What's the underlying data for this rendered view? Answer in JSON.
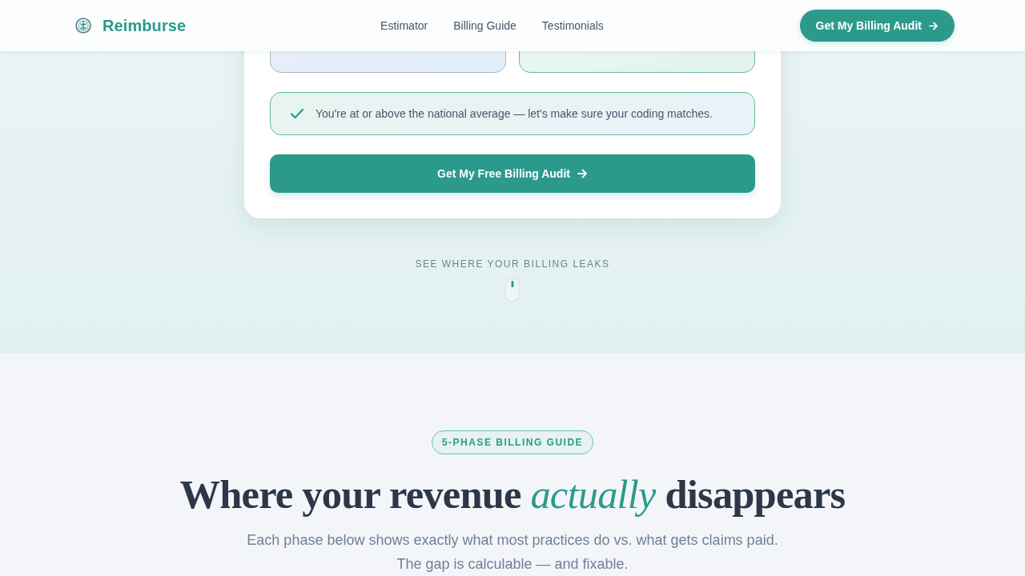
{
  "header": {
    "brand": "Reimburse",
    "nav": [
      {
        "label": "Estimator"
      },
      {
        "label": "Billing Guide"
      },
      {
        "label": "Testimonials"
      }
    ],
    "cta": "Get My Billing Audit"
  },
  "estimator": {
    "stats": [
      {
        "highlighted": false
      },
      {
        "highlighted": true
      }
    ],
    "notice": "You're at or above the national average — let's make sure your coding matches.",
    "submit": "Get My Free Billing Audit"
  },
  "scroll_hint": "SEE WHERE YOUR BILLING LEAKS",
  "guide": {
    "badge": "5-PHASE BILLING GUIDE",
    "title": "Where your revenue *actually* disappears",
    "subtitle": "Each phase below shows exactly what most practices do vs. what gets claims paid. The gap is calculable — and fixable."
  }
}
